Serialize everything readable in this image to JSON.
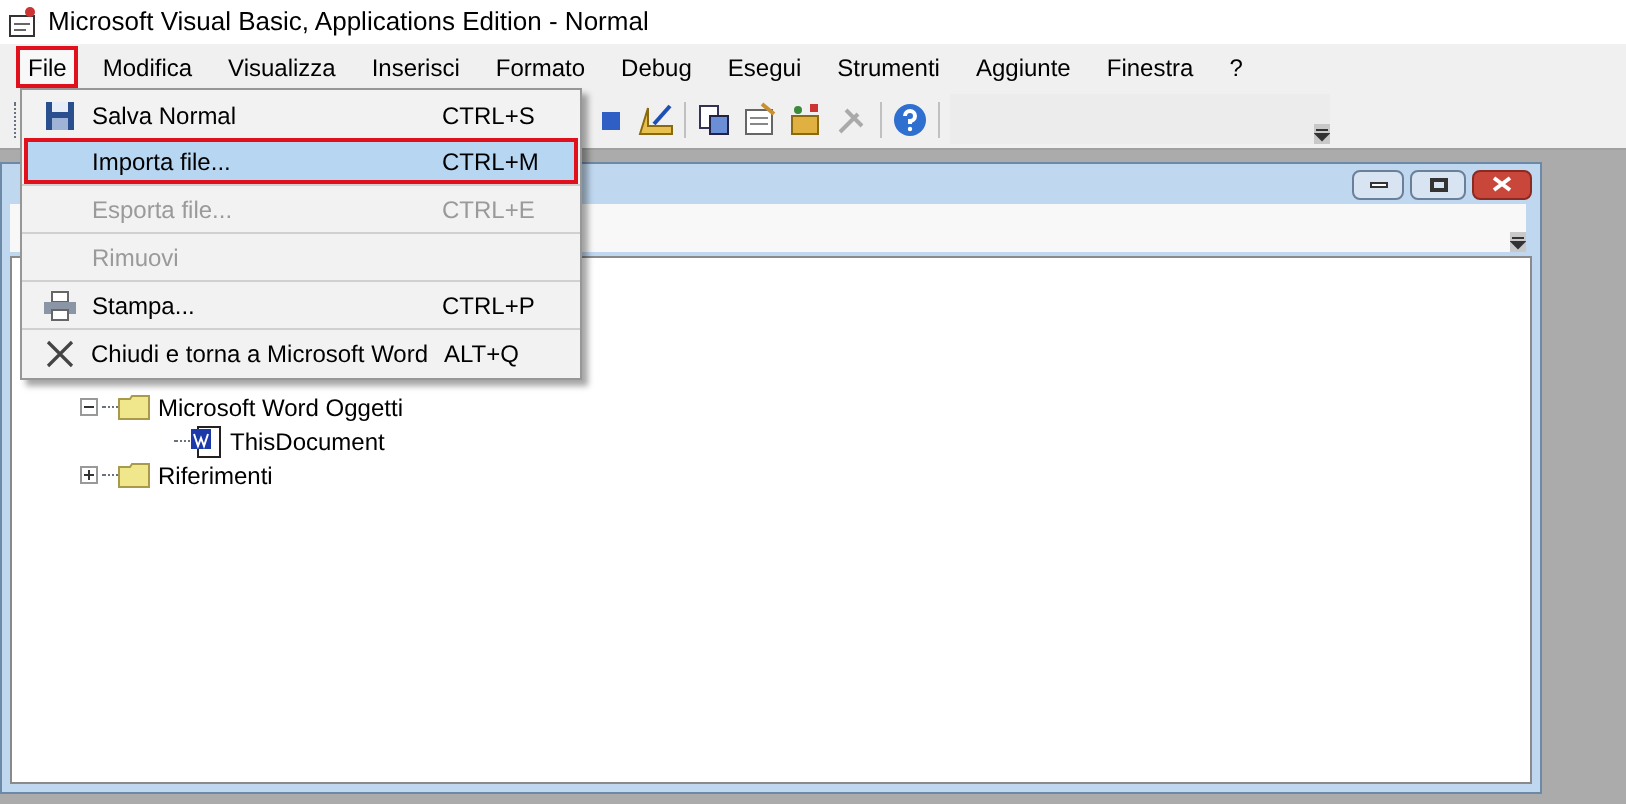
{
  "window": {
    "title": "Microsoft Visual Basic, Applications Edition - Normal"
  },
  "menubar": [
    {
      "label": "File",
      "selected": true
    },
    {
      "label": "Modifica",
      "selected": false
    },
    {
      "label": "Visualizza",
      "selected": false
    },
    {
      "label": "Inserisci",
      "selected": false
    },
    {
      "label": "Formato",
      "selected": false
    },
    {
      "label": "Debug",
      "selected": false
    },
    {
      "label": "Esegui",
      "selected": false
    },
    {
      "label": "Strumenti",
      "selected": false
    },
    {
      "label": "Aggiunte",
      "selected": false
    },
    {
      "label": "Finestra",
      "selected": false
    },
    {
      "label": "?",
      "selected": false
    }
  ],
  "file_menu": [
    {
      "kind": "save",
      "label": "Salva Normal",
      "shortcut": "CTRL+S",
      "disabled": false,
      "selected": false
    },
    {
      "kind": "none",
      "label": "Importa file...",
      "shortcut": "CTRL+M",
      "disabled": false,
      "selected": true
    },
    {
      "kind": "none",
      "label": "Esporta file...",
      "shortcut": "CTRL+E",
      "disabled": true,
      "selected": false
    },
    {
      "kind": "none",
      "label": "Rimuovi",
      "disabled": true,
      "selected": false
    },
    {
      "kind": "print",
      "label": "Stampa...",
      "shortcut": "CTRL+P",
      "disabled": false,
      "selected": false
    },
    {
      "kind": "close",
      "label": "Chiudi e torna a Microsoft Word",
      "shortcut": "ALT+Q",
      "disabled": false,
      "selected": false
    }
  ],
  "tree": [
    {
      "kind": "folder",
      "label": "Microsoft Word Oggetti",
      "expanded": true,
      "children": [
        {
          "kind": "document",
          "label": "ThisDocument"
        }
      ]
    },
    {
      "kind": "folder",
      "label": "Riferimenti",
      "expanded": false
    }
  ]
}
